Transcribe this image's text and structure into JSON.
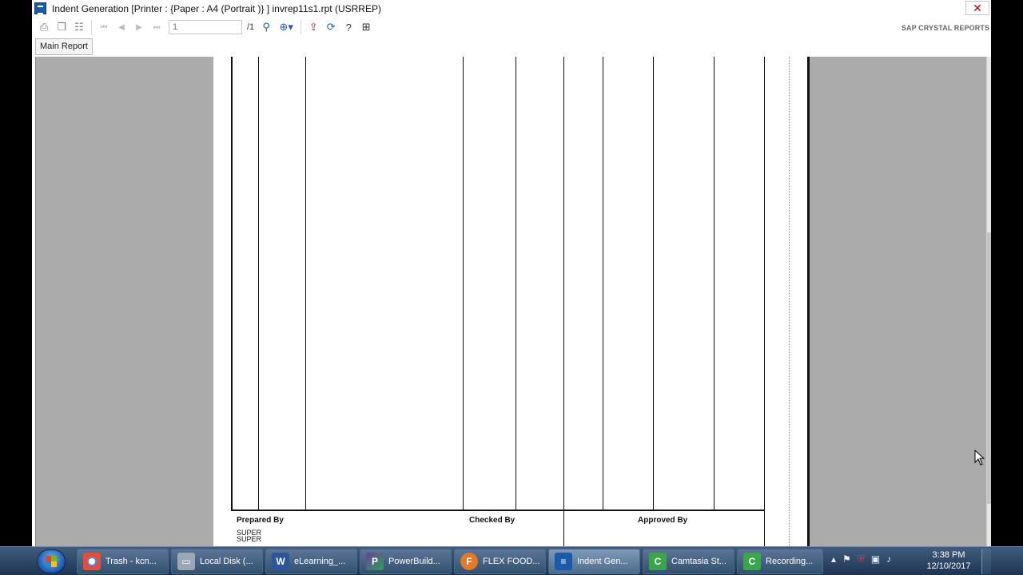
{
  "window": {
    "title": "Indent Generation [Printer : {Paper : A4 (Portrait )} ]    invrep11s1.rpt   (USRREP)",
    "close_symbol": "✕"
  },
  "toolbar": {
    "page_value": "1",
    "page_total": "/1",
    "brand": "SAP CRYSTAL REPORTS",
    "icons": [
      "print-icon",
      "copy-icon",
      "group-tree-icon",
      "first-page-icon",
      "previous-page-icon",
      "next-page-icon",
      "last-page-icon",
      "find-icon",
      "zoom-icon",
      "export-icon",
      "refresh-icon",
      "help-icon",
      "drilldown-icon"
    ]
  },
  "tabs": {
    "main": "Main Report"
  },
  "report": {
    "prepared_by_label": "Prepared By",
    "prepared_by_value_1": "SUPER",
    "prepared_by_value_2": "SUPER",
    "checked_by_label": "Checked  By",
    "approved_by_label": "Approved By"
  },
  "taskbar": {
    "items": [
      {
        "label": "Trash - kcn...",
        "icon": "chrome-icon",
        "color": "#e84b37"
      },
      {
        "label": "Local Disk (...",
        "icon": "drive-icon",
        "color": "#9aa7b4"
      },
      {
        "label": "eLearning_...",
        "icon": "word-icon",
        "color": "#2b579a"
      },
      {
        "label": "PowerBuild...",
        "icon": "powerbuilder-icon",
        "color": "#6a3f9c"
      },
      {
        "label": "FLEX FOOD...",
        "icon": "flex-icon",
        "color": "#e07b2a"
      },
      {
        "label": "Indent Gen...",
        "icon": "crystal-icon",
        "color": "#1b5aa8"
      },
      {
        "label": "Camtasia St...",
        "icon": "camtasia-icon",
        "color": "#3aa64b"
      },
      {
        "label": "Recording...",
        "icon": "recorder-icon",
        "color": "#3aa64b"
      }
    ],
    "time": "3:38 PM",
    "date": "12/10/2017"
  }
}
